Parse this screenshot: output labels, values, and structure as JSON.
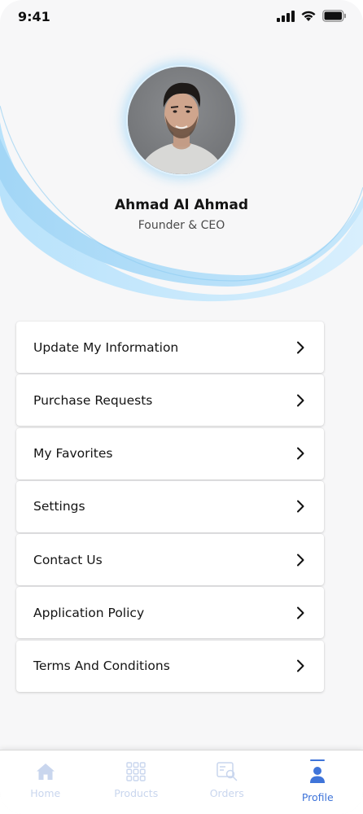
{
  "status_bar": {
    "time": "9:41",
    "icons": [
      "signal-icon",
      "wifi-icon",
      "battery-icon"
    ]
  },
  "profile": {
    "name": "Ahmad Al Ahmad",
    "role": "Founder & CEO",
    "avatar": "user-avatar-photo"
  },
  "menu": {
    "items": [
      {
        "label": "Update My Information",
        "icon": "chevron-right-icon"
      },
      {
        "label": "Purchase Requests",
        "icon": "chevron-right-icon"
      },
      {
        "label": "My Favorites",
        "icon": "chevron-right-icon"
      },
      {
        "label": "Settings",
        "icon": "chevron-right-icon"
      },
      {
        "label": "Contact Us",
        "icon": "chevron-right-icon"
      },
      {
        "label": "Application Policy",
        "icon": "chevron-right-icon"
      },
      {
        "label": "Terms And Conditions",
        "icon": "chevron-right-icon"
      }
    ]
  },
  "bottom_nav": {
    "items": [
      {
        "label": "Home",
        "icon": "home-icon",
        "active": false
      },
      {
        "label": "Products",
        "icon": "grid-icon",
        "active": false
      },
      {
        "label": "Orders",
        "icon": "orders-icon",
        "active": false
      },
      {
        "label": "Profile",
        "icon": "user-icon",
        "active": true
      }
    ]
  },
  "colors": {
    "accent": "#3f74d9",
    "inactive_nav": "#c9d6ee",
    "wave_light": "#c9e8fb",
    "wave_mid": "#a9d9f7",
    "background": "#f7f7f8"
  }
}
